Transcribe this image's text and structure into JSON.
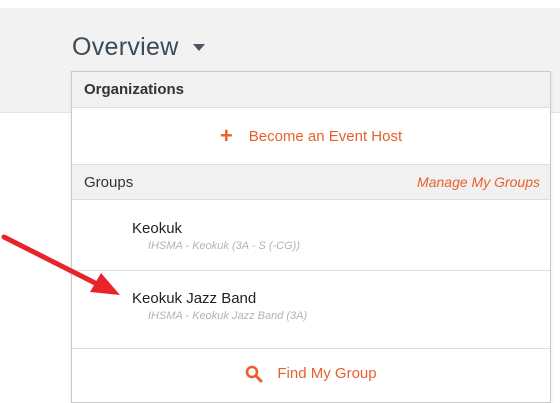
{
  "header": {
    "title": "Overview",
    "caret_icon": "caret-down-icon"
  },
  "dropdown": {
    "organizations": {
      "title": "Organizations",
      "action": {
        "label": "Become an Event Host",
        "icon": "plus-icon"
      }
    },
    "groups": {
      "title": "Groups",
      "manage_label": "Manage My Groups",
      "items": [
        {
          "name": "Keokuk",
          "subtitle": "IHSMA - Keokuk (3A - S (-CG))"
        },
        {
          "name": "Keokuk Jazz Band",
          "subtitle": "IHSMA - Keokuk Jazz Band (3A)"
        }
      ],
      "find": {
        "label": "Find My Group",
        "icon": "search-icon"
      }
    }
  },
  "annotation": {
    "arrow_color": "#e8232a",
    "points_to": "Keokuk Jazz Band"
  },
  "colors": {
    "accent": "#e8602c",
    "header_bg": "#f1f1f1",
    "topbar_bg": "#f2f2f2",
    "title_text": "#3d4a57"
  }
}
